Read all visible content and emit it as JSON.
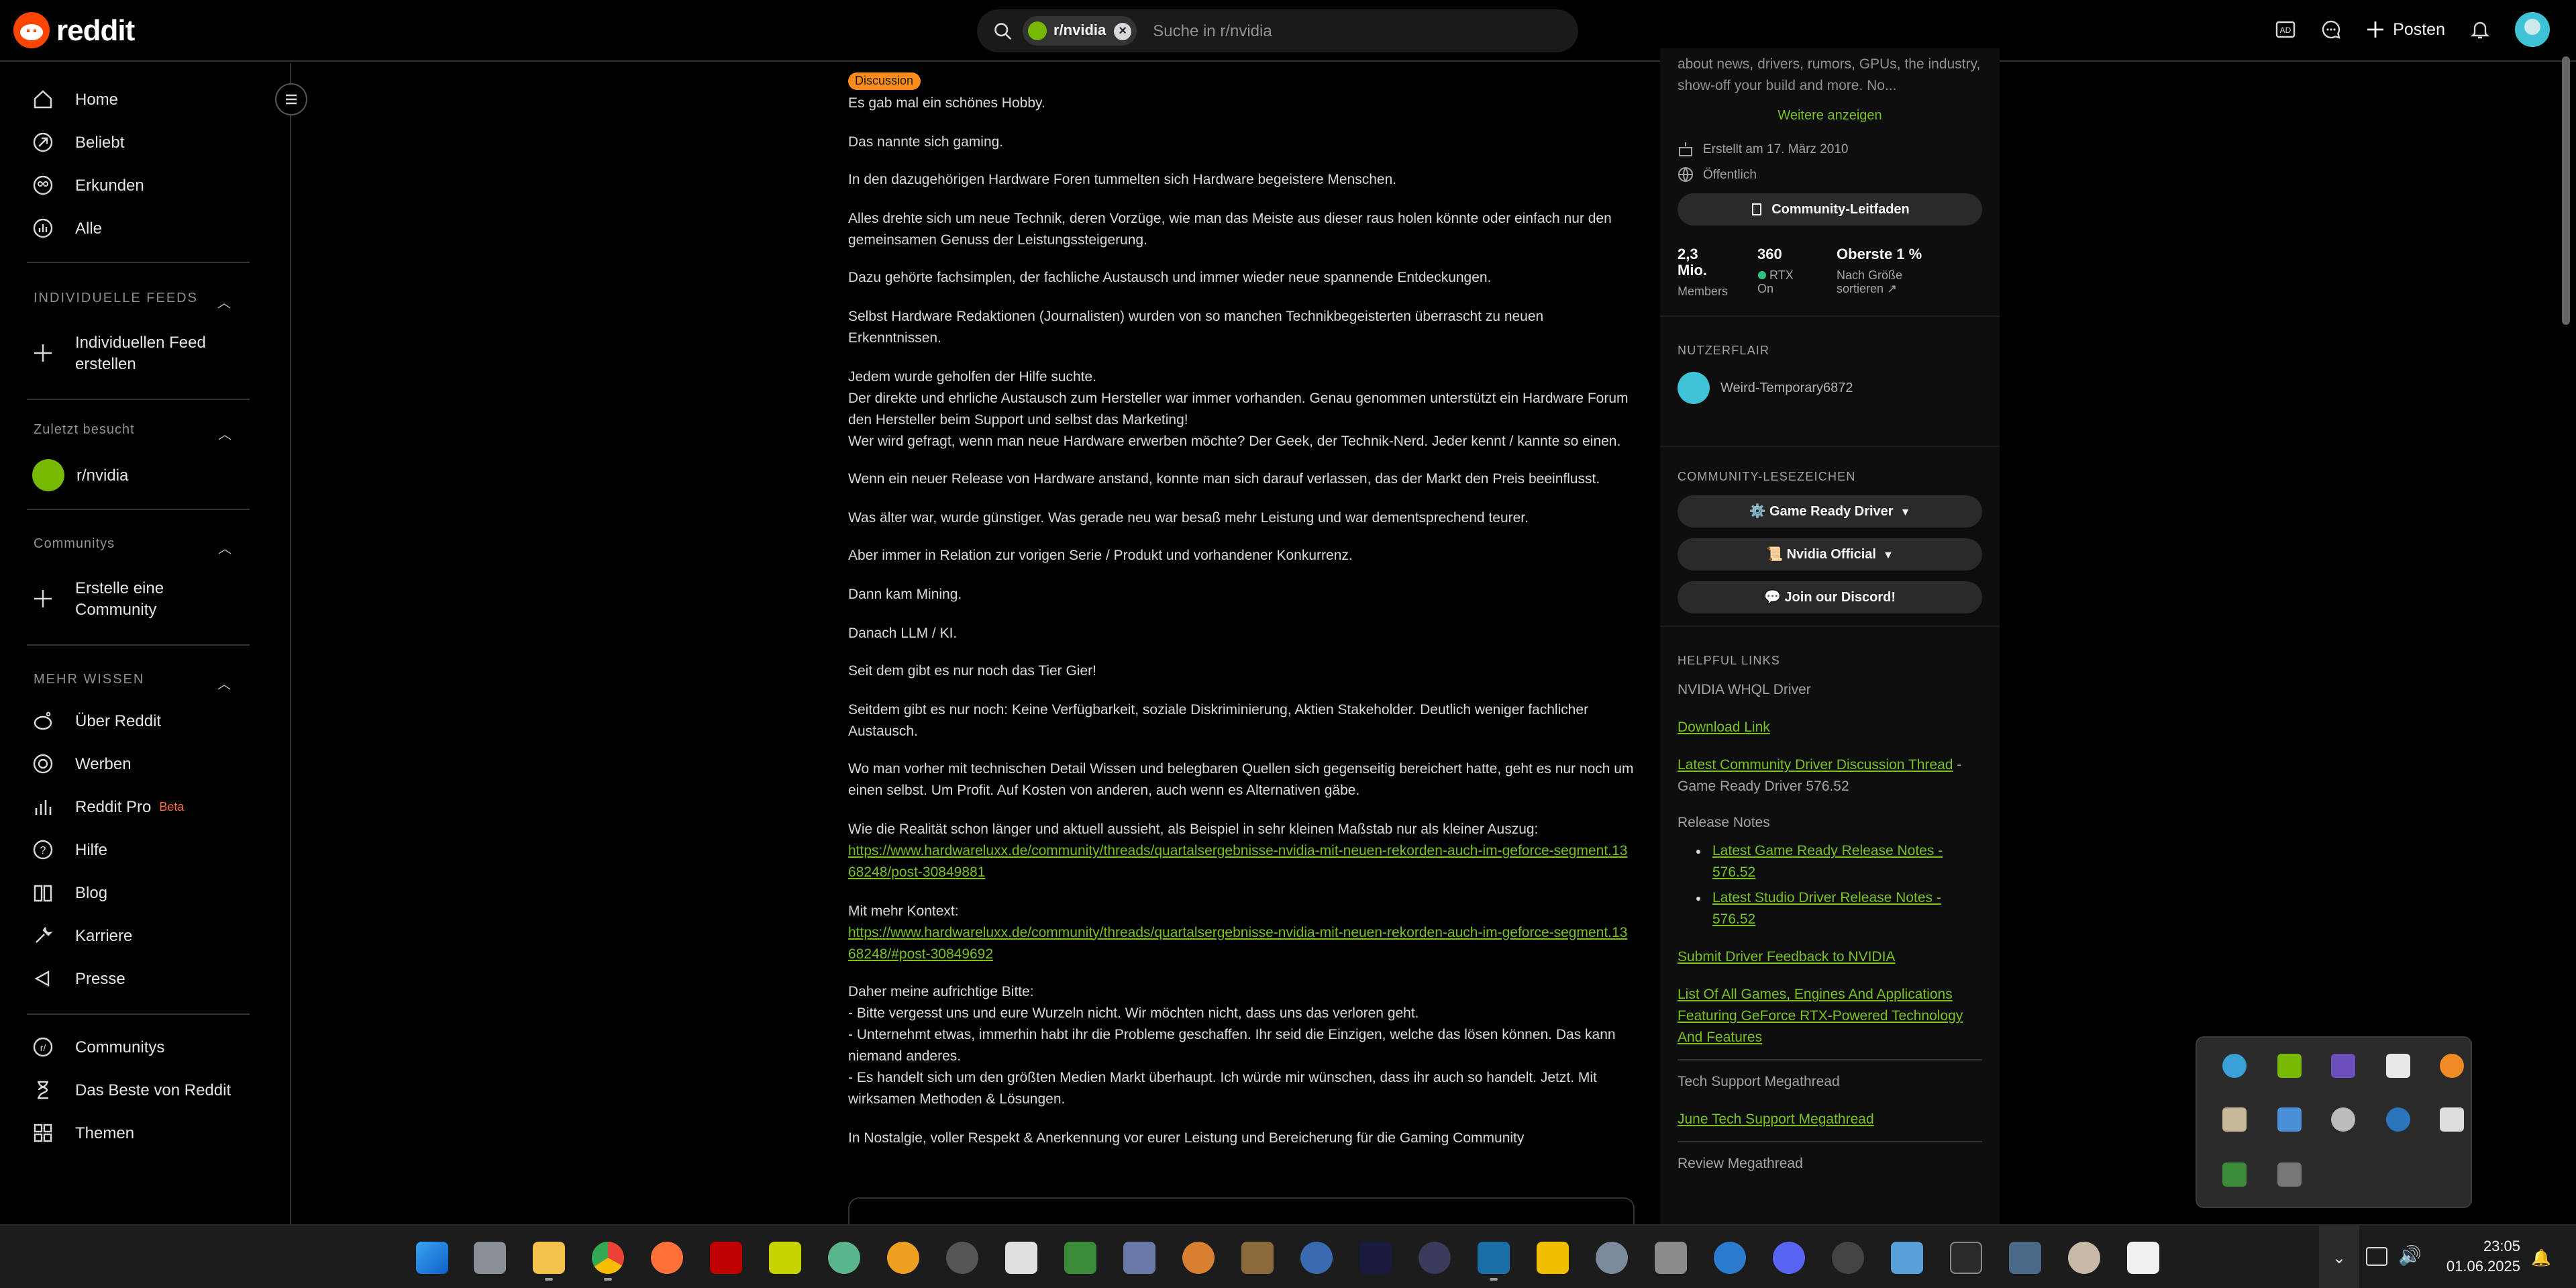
{
  "header": {
    "logo_text": "reddit",
    "search_chip": "r/nvidia",
    "search_placeholder": "Suche in r/nvidia",
    "post_label": "Posten"
  },
  "sidebar": {
    "main_items": [
      {
        "label": "Home",
        "icon": "home-icon"
      },
      {
        "label": "Beliebt",
        "icon": "popular-icon"
      },
      {
        "label": "Erkunden",
        "icon": "explore-icon"
      },
      {
        "label": "Alle",
        "icon": "all-icon"
      }
    ],
    "feeds_header": "INDIVIDUELLE FEEDS",
    "create_feed": "Individuellen Feed\nerstellen",
    "recent_header": "Zuletzt besucht",
    "recent_item": "r/nvidia",
    "communities_header": "Communitys",
    "create_community": "Erstelle eine\nCommunity",
    "more_header": "MEHR WISSEN",
    "more_items": [
      {
        "label": "Über Reddit",
        "icon": "reddit-icon"
      },
      {
        "label": "Werben",
        "icon": "advertise-icon"
      },
      {
        "label": "Reddit Pro",
        "icon": "chart-icon"
      },
      {
        "label": "Hilfe",
        "icon": "help-icon"
      },
      {
        "label": "Blog",
        "icon": "book-icon"
      },
      {
        "label": "Karriere",
        "icon": "wrench-icon"
      },
      {
        "label": "Presse",
        "icon": "mic-icon"
      }
    ],
    "reddit_pro_badge": "Beta",
    "bottom_items": [
      {
        "label": "Communitys",
        "icon": "communities-icon"
      },
      {
        "label": "Das Beste von Reddit",
        "icon": "hourglass-icon"
      },
      {
        "label": "Themen",
        "icon": "topics-icon"
      }
    ]
  },
  "post": {
    "flair": "Discussion",
    "paragraphs": [
      "Es gab mal ein schönes Hobby.",
      "Das nannte sich gaming.",
      "In den dazugehörigen Hardware Foren tummelten sich Hardware begeistere Menschen.",
      "Alles drehte sich um neue Technik, deren Vorzüge, wie man das Meiste aus dieser raus holen könnte oder einfach nur den gemeinsamen Genuss der Leistungssteigerung.",
      "Dazu gehörte fachsimplen, der fachliche Austausch und immer wieder neue spannende Entdeckungen.",
      "Selbst Hardware Redaktionen (Journalisten) wurden von so manchen Technikbegeisterten überrascht zu neuen Erkenntnissen.",
      "Jedem wurde geholfen der Hilfe suchte.\nDer direkte und ehrliche Austausch zum Hersteller war immer vorhanden. Genau genommen unterstützt ein Hardware Forum den Hersteller beim Support und selbst das Marketing!\nWer wird gefragt, wenn man neue Hardware erwerben möchte? Der Geek, der Technik-Nerd. Jeder kennt / kannte so einen.",
      "Wenn ein neuer Release von Hardware anstand, konnte man sich darauf verlassen, das der Markt den Preis beeinflusst.",
      "Was älter war, wurde günstiger. Was gerade neu war besaß mehr Leistung und war dementsprechend teurer.",
      "Aber immer in Relation zur vorigen Serie / Produkt und vorhandener Konkurrenz.",
      "Dann kam Mining.",
      "Danach LLM / KI.",
      "Seit dem gibt es nur noch das Tier Gier!",
      "Seitdem gibt es nur noch: Keine Verfügbarkeit, soziale Diskriminierung, Aktien Stakeholder. Deutlich weniger fachlicher Austausch.",
      "Wo man vorher mit technischen Detail Wissen und belegbaren Quellen sich gegenseitig bereichert hatte, geht es nur noch um einen selbst. Um Profit. Auf Kosten von anderen, auch wenn es Alternativen gäbe."
    ],
    "example_intro": "Wie die Realität schon länger und aktuell aussieht, als Beispiel in sehr kleinen Maßstab nur als kleiner Auszug:",
    "link1": "https://www.hardwareluxx.de/community/threads/quartalsergebnisse-nvidia-mit-neuen-rekorden-auch-im-geforce-segment.1368248/post-30849881",
    "context_intro": "Mit mehr Kontext:",
    "link2": "https://www.hardwareluxx.de/community/threads/quartalsergebnisse-nvidia-mit-neuen-rekorden-auch-im-geforce-segment.1368248/#post-30849692",
    "plea": "Daher meine aufrichtige Bitte:\n- Bitte vergesst uns und eure Wurzeln nicht. Wir möchten nicht, dass uns das verloren geht.\n- Unternehmt etwas, immerhin habt ihr die Probleme geschaffen. Ihr seid die Einzigen, welche das lösen können. Das kann niemand anderes.\n- Es handelt sich um den größten Medien Markt überhaupt. Ich würde mir wünschen, dass ihr auch so handelt. Jetzt. Mit wirksamen Methoden & Lösungen.",
    "closing": "In Nostalgie, voller Respekt & Anerkennung vor eurer Leistung und Bereicherung für die Gaming Community"
  },
  "community": {
    "description": "about news, drivers, rumors, GPUs, the industry, show-off your build and more. No...",
    "show_more": "Weitere anzeigen",
    "created": "Erstellt am 17. März 2010",
    "visibility": "Öffentlich",
    "guidelines_button": "Community-Leitfaden",
    "stats": [
      {
        "value": "2,3 Mio.",
        "label": "Members"
      },
      {
        "value": "360",
        "label": "RTX On"
      },
      {
        "value": "Oberste 1 %",
        "label": "Nach Größe sortieren"
      }
    ],
    "user_flair_header": "NUTZERFLAIR",
    "user_flair_name": "Weird-Temporary6872",
    "bookmarks_header": "COMMUNITY-LESEZEICHEN",
    "bookmarks": [
      "⚙️ Game Ready Driver",
      "📜 Nvidia Official",
      "💬 Join our Discord!"
    ],
    "helpful_header": "HELPFUL LINKS",
    "whql": "NVIDIA WHQL Driver",
    "download": "Download Link",
    "latest_thread": "Latest Community Driver Discussion Thread",
    "latest_thread_suffix": " - Game Ready Driver 576.52",
    "release_notes": "Release Notes",
    "release_links": [
      "Latest Game Ready Release Notes - 576.52",
      "Latest Studio Driver Release Notes - 576.52"
    ],
    "feedback": "Submit Driver Feedback to NVIDIA",
    "rtx_list": "List Of All Games, Engines And Applications Featuring GeForce RTX-Powered Technology And Features",
    "tech_support": "Tech Support Megathread",
    "june_support": "June Tech Support Megathread",
    "review": "Review Megathread"
  },
  "taskbar": {
    "time": "23:05",
    "date": "01.06.2025"
  },
  "colors": {
    "accent_link": "#78c320",
    "flair": "#ff8c1a",
    "reddit_orange": "#ff4500",
    "nvidia_green": "#76b900"
  }
}
